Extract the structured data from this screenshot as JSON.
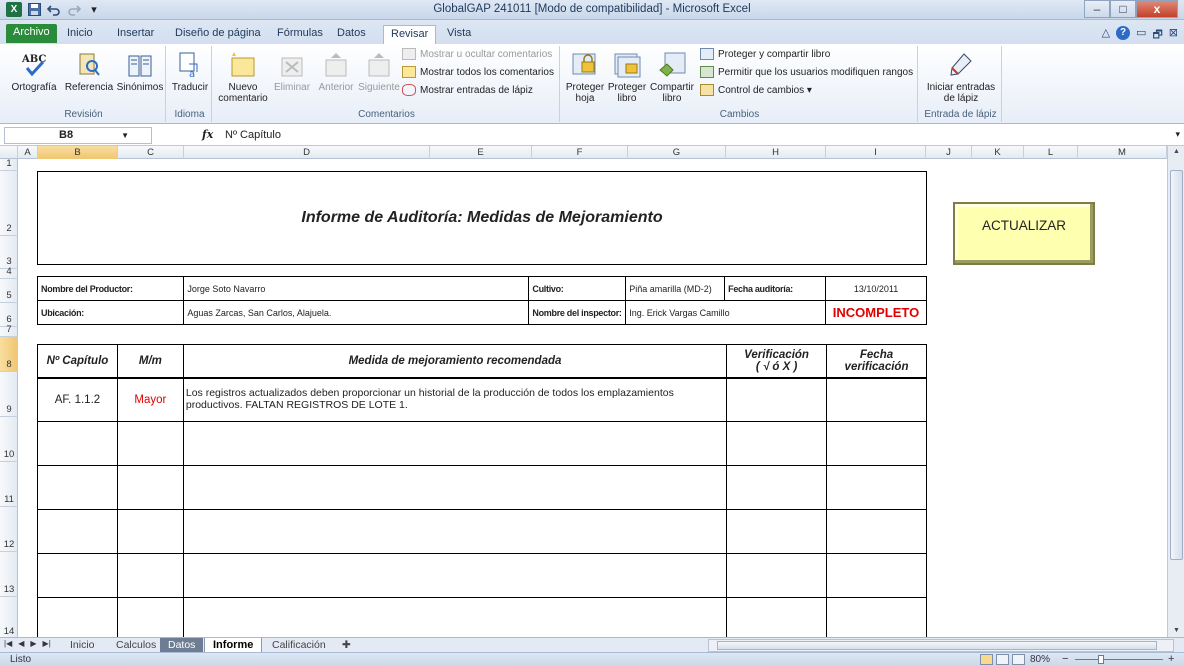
{
  "window": {
    "title": "GlobalGAP 241011  [Modo de compatibilidad]  -  Microsoft Excel",
    "minimize": "–",
    "maximize": "□",
    "close": "x"
  },
  "ribbon_tabs": [
    "Archivo",
    "Inicio",
    "Insertar",
    "Diseño de página",
    "Fórmulas",
    "Datos",
    "Revisar",
    "Vista"
  ],
  "ribbon": {
    "revision": {
      "label": "Revisión",
      "ortografia": "Ortografía",
      "referencia": "Referencia",
      "sinonimos": "Sinónimos",
      "abc": "ABC"
    },
    "idioma": {
      "label": "Idioma",
      "traducir": "Traducir"
    },
    "comentarios": {
      "label": "Comentarios",
      "nuevo": "Nuevo",
      "nuevo2": "comentario",
      "eliminar": "Eliminar",
      "anterior": "Anterior",
      "siguiente": "Siguiente",
      "mostrar_ocultar": "Mostrar u ocultar comentarios",
      "mostrar_todos": "Mostrar todos los comentarios",
      "mostrar_lapiz": "Mostrar entradas de lápiz"
    },
    "cambios": {
      "label": "Cambios",
      "proteger_hoja_1": "Proteger",
      "proteger_hoja_2": "hoja",
      "proteger_libro_1": "Proteger",
      "proteger_libro_2": "libro",
      "compartir_1": "Compartir",
      "compartir_2": "libro",
      "proteger_compartir": "Proteger y compartir libro",
      "permitir": "Permitir que los usuarios modifiquen rangos",
      "control": "Control de cambios ▾"
    },
    "lapiz": {
      "label": "Entrada de lápiz",
      "iniciar_1": "Iniciar entradas",
      "iniciar_2": "de lápiz"
    }
  },
  "formula_bar": {
    "name_box": "B8",
    "fx": "fx",
    "value": "Nº Capítulo"
  },
  "columns": [
    "A",
    "B",
    "C",
    "D",
    "E",
    "F",
    "G",
    "H",
    "I",
    "J",
    "K",
    "L",
    "M"
  ],
  "rows": [
    "1",
    "2",
    "3",
    "4",
    "5",
    "6",
    "7",
    "8",
    "9",
    "10",
    "11",
    "12",
    "13",
    "14"
  ],
  "report": {
    "title": "Informe de Auditoría: Medidas de Mejoramiento",
    "productor_label": "Nombre del Productor:",
    "productor": "Jorge Soto Navarro",
    "cultivo_label": "Cultivo:",
    "cultivo": "Piña amarilla (MD-2)",
    "fecha_label": "Fecha auditoría:",
    "fecha": "13/10/2011",
    "ubicacion_label": "Ubicación:",
    "ubicacion": "Aguas Zarcas, San Carlos, Alajuela.",
    "inspector_label": "Nombre del inspector:",
    "inspector": "Ing. Erick Vargas Camillo",
    "estado": "INCOMPLETO",
    "headers": {
      "capitulo": "Nº Capítulo",
      "mm": "M/m",
      "medida": "Medida de mejoramiento recomendada",
      "verificacion_1": "Verificación",
      "verificacion_2": "( √  ó  X )",
      "fecha_ver_1": "Fecha",
      "fecha_ver_2": "verificación"
    },
    "rows": [
      {
        "capitulo": "AF. 1.1.2",
        "mm": "Mayor",
        "medida": "Los registros actualizados deben proporcionar un historial de la producción de todos los emplazamientos productivos. FALTAN REGISTROS DE LOTE 1."
      }
    ]
  },
  "actualizar_button": "ACTUALIZAR",
  "sheet_tabs": [
    "Inicio",
    "Calculos",
    "Datos",
    "Informe",
    "Calificación"
  ],
  "status": {
    "ready": "Listo",
    "zoom": "80%",
    "zoom_out": "−",
    "zoom_in": "+"
  }
}
